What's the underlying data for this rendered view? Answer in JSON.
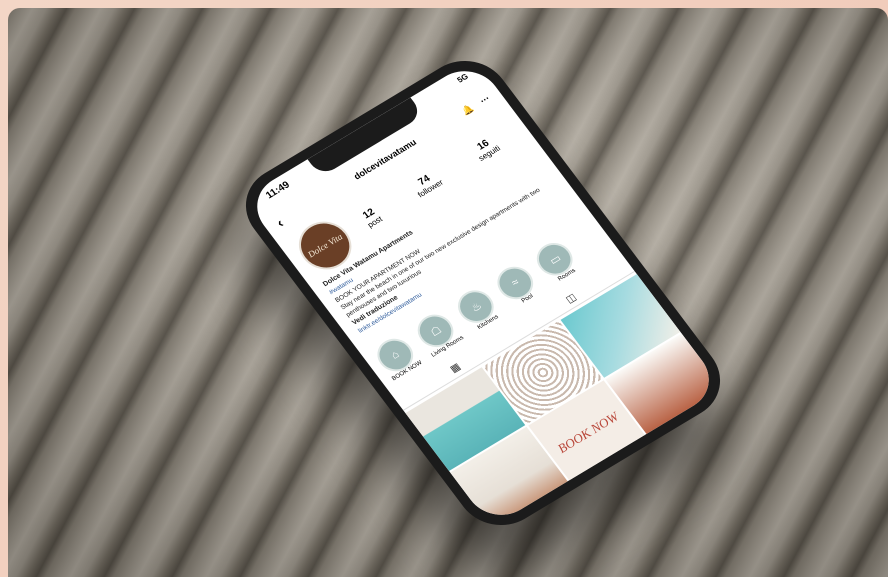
{
  "status": {
    "time": "11:49",
    "signal": "5G"
  },
  "header": {
    "username": "dolcevitavatamu"
  },
  "profile": {
    "avatar_text": "Dolce Vita",
    "stats": [
      {
        "value": "12",
        "label": "post"
      },
      {
        "value": "74",
        "label": "follower"
      },
      {
        "value": "16",
        "label": "seguiti"
      }
    ]
  },
  "bio": {
    "name": "Dolce Vita Watamu Apartments",
    "tag": "#watamu",
    "line1": "BOOK YOUR APARTMENT NOW",
    "line2": "Stay near the beach in one of our two new exclusive design apartments with two penthouses and two luxurious",
    "line3": "Vedi traduzione",
    "link": "linktr.ee/dolcevitawatamu"
  },
  "highlights": [
    {
      "label": "BOOK NOW",
      "icon": "bed-icon"
    },
    {
      "label": "Living Rooms",
      "icon": "sofa-icon"
    },
    {
      "label": "Kitchens",
      "icon": "kitchen-icon"
    },
    {
      "label": "Pool",
      "icon": "pool-icon"
    },
    {
      "label": "Rooms",
      "icon": "room-icon"
    }
  ],
  "grid_post_text": "BOOK NOW"
}
